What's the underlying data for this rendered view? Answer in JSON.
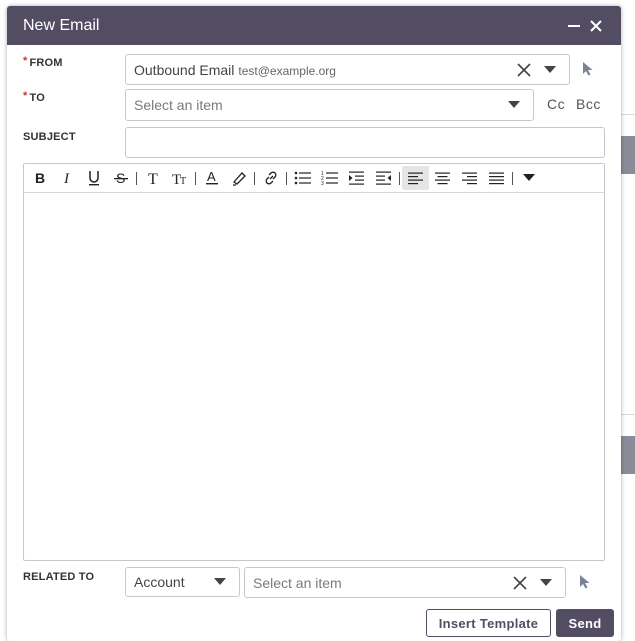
{
  "dialog": {
    "title": "New Email",
    "minimize_icon": "minimize-icon",
    "close_icon": "close-icon"
  },
  "from": {
    "label": "FROM",
    "required_mark": "*",
    "value": "Outbound Email",
    "email": "test@example.org",
    "clear_icon": "clear-icon",
    "dropdown_icon": "chevron-down-icon",
    "select_icon": "cursor-select-icon"
  },
  "to": {
    "label": "TO",
    "required_mark": "*",
    "placeholder": "Select an item",
    "dropdown_icon": "chevron-down-icon",
    "cc_label": "Cc",
    "bcc_label": "Bcc"
  },
  "subject": {
    "label": "SUBJECT",
    "value": ""
  },
  "toolbar": {
    "buttons": [
      "bold",
      "italic",
      "underline",
      "strikethrough",
      "font-family",
      "font-size",
      "text-color",
      "highlight",
      "link",
      "bullet-list",
      "numbered-list",
      "indent",
      "outdent",
      "align-left",
      "align-center",
      "align-right",
      "align-justify",
      "more"
    ],
    "active": "align-left"
  },
  "related": {
    "label": "RELATED TO",
    "module_value": "Account",
    "record_placeholder": "Select an item",
    "clear_icon": "clear-icon",
    "dropdown_icon": "chevron-down-icon",
    "select_icon": "cursor-select-icon"
  },
  "actions": {
    "insert_template_label": "Insert Template",
    "send_label": "Send"
  },
  "colors": {
    "accent": "#534d64",
    "required": "#c0392b"
  }
}
